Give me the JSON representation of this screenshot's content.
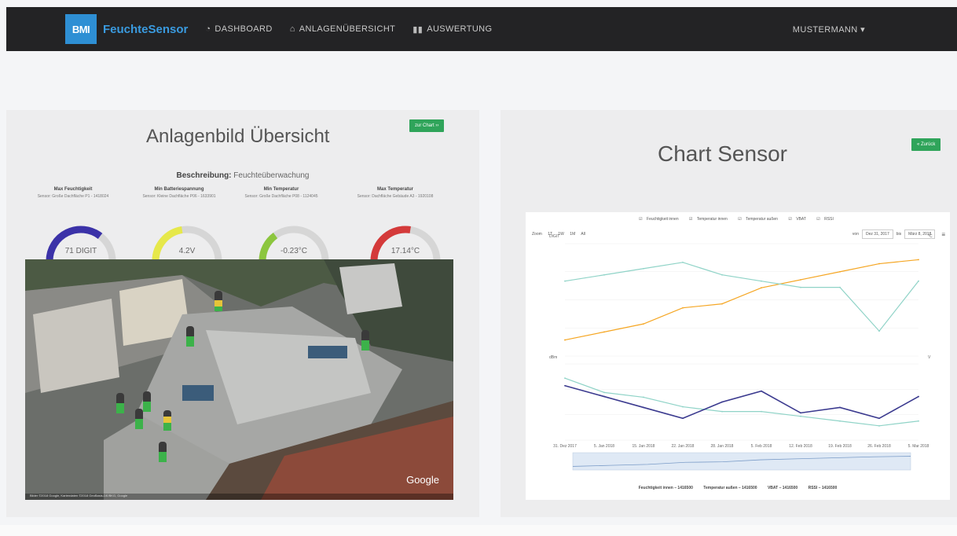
{
  "navbar": {
    "logo": "BMI",
    "brand": "FeuchteSensor",
    "items": [
      {
        "label": "DASHBOARD",
        "icon": "tachometer-icon"
      },
      {
        "label": "ANLAGENÜBERSICHT",
        "icon": "home-icon"
      },
      {
        "label": "AUSWERTUNG",
        "icon": "bar-chart-icon"
      }
    ],
    "user": "MUSTERMANN ▾"
  },
  "left_panel": {
    "title": "Anlagenbild Übersicht",
    "button": "zur Chart ››",
    "beschreibung_label": "Beschreibung:",
    "beschreibung_value": " Feuchteüberwachung",
    "gauges": [
      {
        "title": "Max Feuchtigkeit",
        "subtitle": "Sensor: Große Dachfläche P1 - 1418024",
        "value": "71 DIGIT",
        "level": 0.71,
        "color": "#3b32a8"
      },
      {
        "title": "Min Batteriespannung",
        "subtitle": "Sensor: Kleine Dachfläche P06 - 1633901",
        "value": "4.2V",
        "level": 0.45,
        "color": "#e6e84a"
      },
      {
        "title": "Min Temperatur",
        "subtitle": "Sensor: Große Dachfläche P08 - 1124045",
        "value": "-0.23°C",
        "level": 0.3,
        "color": "#8cc63e"
      },
      {
        "title": "Max Temperatur",
        "subtitle": "Sensor: Dachfläche Gebäude A3 - 1920108",
        "value": "17.14°C",
        "level": 0.55,
        "color": "#d43a3a"
      }
    ],
    "photo_watermark": "Google",
    "photo_attribution": "Bilder ©2018 Google, Kartendaten ©2018 GeoBasis-DE/BKG, Google"
  },
  "right_panel": {
    "title": "Chart Sensor",
    "button": "« Zurück",
    "chart_legend_top": [
      "Feuchtigkeit innen",
      "Temperatur innen",
      "Temperatur außen",
      "VBAT",
      "RSSI"
    ],
    "zoom_label": "Zoom",
    "zoom_options": [
      "1T",
      "1W",
      "1M",
      "All"
    ],
    "range_from_label": "von",
    "range_from": "Dez 31, 2017",
    "range_to_label": "bis",
    "range_to": "März 8, 2018",
    "left_axis_unit_top": "DIGIT",
    "left_axis_unit_bottom": "dBm",
    "right_axis_unit_top": "°C",
    "right_axis_unit_bottom": "V",
    "x_ticks": [
      "31. Dez 2017",
      "5. Jan 2018",
      "15. Jan 2018",
      "22. Jan 2018",
      "28. Jan 2018",
      "5. Feb 2018",
      "12. Feb 2018",
      "19. Feb 2018",
      "26. Feb 2018",
      "5. Mar 2018"
    ],
    "chart_legend_bottom": [
      "Feuchtigkeit innen – 1416500",
      "Temperatur außen – 1416500",
      "VBAT – 1416500",
      "RSSI – 1416500"
    ],
    "colors": {
      "humidity": "#f5a623",
      "temp_out": "#8fd3c7",
      "vbat": "#8fd3c7",
      "rssi": "#3b3a8f"
    }
  },
  "chart_data": {
    "type": "line",
    "x": [
      "31. Dez 2017",
      "5. Jan 2018",
      "15. Jan 2018",
      "22. Jan 2018",
      "28. Jan 2018",
      "5. Feb 2018",
      "12. Feb 2018",
      "19. Feb 2018",
      "26. Feb 2018",
      "5. Mar 2018"
    ],
    "series": [
      {
        "name": "Feuchtigkeit innen",
        "values": [
          52,
          54,
          56,
          60,
          61,
          65,
          67,
          69,
          71,
          72
        ]
      },
      {
        "name": "Temperatur außen",
        "values": [
          2,
          3,
          4,
          5,
          3,
          2,
          1,
          1,
          -6,
          2
        ]
      },
      {
        "name": "VBAT",
        "values": [
          4.45,
          4.3,
          4.25,
          4.15,
          4.1,
          4.1,
          4.05,
          4.0,
          3.95,
          4.0
        ]
      },
      {
        "name": "RSSI",
        "values": [
          -70,
          -72,
          -74,
          -76,
          -73,
          -71,
          -75,
          -74,
          -76,
          -72
        ]
      }
    ]
  }
}
